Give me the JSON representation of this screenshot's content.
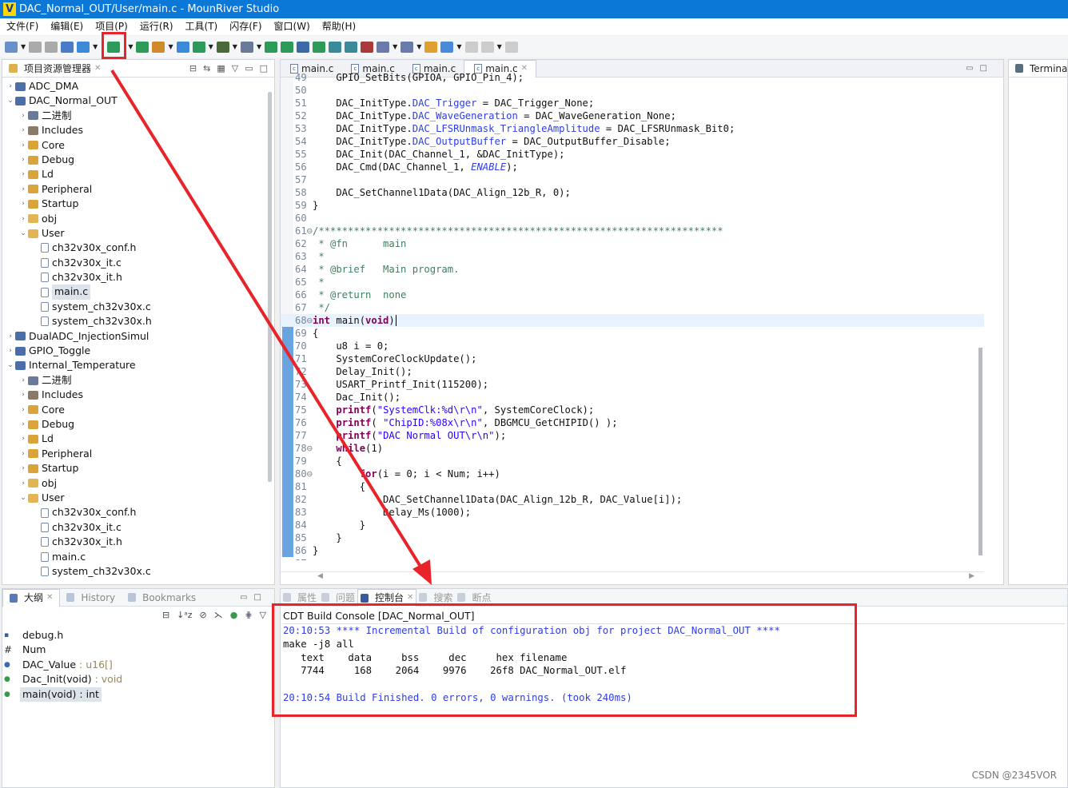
{
  "window": {
    "title": "DAC_Normal_OUT/User/main.c - MounRiver Studio"
  },
  "menu": [
    "文件(F)",
    "编辑(E)",
    "项目(P)",
    "运行(R)",
    "工具(T)",
    "闪存(F)",
    "窗口(W)",
    "帮助(H)"
  ],
  "project_explorer": {
    "title": "项目资源管理器",
    "items": [
      {
        "label": "ADC_DMA",
        "depth": 0,
        "icon": "project",
        "expanded": false
      },
      {
        "label": "DAC_Normal_OUT",
        "depth": 0,
        "icon": "project",
        "expanded": true
      },
      {
        "label": "二进制",
        "depth": 1,
        "icon": "binary",
        "expanded": false
      },
      {
        "label": "Includes",
        "depth": 1,
        "icon": "includes",
        "expanded": false
      },
      {
        "label": "Core",
        "depth": 1,
        "icon": "folder-src",
        "expanded": false
      },
      {
        "label": "Debug",
        "depth": 1,
        "icon": "folder-src",
        "expanded": false
      },
      {
        "label": "Ld",
        "depth": 1,
        "icon": "folder-src",
        "expanded": false
      },
      {
        "label": "Peripheral",
        "depth": 1,
        "icon": "folder-src",
        "expanded": false
      },
      {
        "label": "Startup",
        "depth": 1,
        "icon": "folder-src",
        "expanded": false
      },
      {
        "label": "obj",
        "depth": 1,
        "icon": "folder",
        "expanded": false
      },
      {
        "label": "User",
        "depth": 1,
        "icon": "folder",
        "expanded": true
      },
      {
        "label": "ch32v30x_conf.h",
        "depth": 2,
        "icon": "file-h"
      },
      {
        "label": "ch32v30x_it.c",
        "depth": 2,
        "icon": "file-c"
      },
      {
        "label": "ch32v30x_it.h",
        "depth": 2,
        "icon": "file-h"
      },
      {
        "label": "main.c",
        "depth": 2,
        "icon": "file-c",
        "selected": true
      },
      {
        "label": "system_ch32v30x.c",
        "depth": 2,
        "icon": "file-c"
      },
      {
        "label": "system_ch32v30x.h",
        "depth": 2,
        "icon": "file-h"
      },
      {
        "label": "DualADC_InjectionSimul",
        "depth": 0,
        "icon": "project",
        "expanded": false
      },
      {
        "label": "GPIO_Toggle",
        "depth": 0,
        "icon": "project",
        "expanded": false
      },
      {
        "label": "Internal_Temperature",
        "depth": 0,
        "icon": "project",
        "expanded": true
      },
      {
        "label": "二进制",
        "depth": 1,
        "icon": "binary",
        "expanded": false
      },
      {
        "label": "Includes",
        "depth": 1,
        "icon": "includes",
        "expanded": false
      },
      {
        "label": "Core",
        "depth": 1,
        "icon": "folder-src",
        "expanded": false
      },
      {
        "label": "Debug",
        "depth": 1,
        "icon": "folder-src",
        "expanded": false
      },
      {
        "label": "Ld",
        "depth": 1,
        "icon": "folder-src",
        "expanded": false
      },
      {
        "label": "Peripheral",
        "depth": 1,
        "icon": "folder-src",
        "expanded": false
      },
      {
        "label": "Startup",
        "depth": 1,
        "icon": "folder-src",
        "expanded": false
      },
      {
        "label": "obj",
        "depth": 1,
        "icon": "folder",
        "expanded": false
      },
      {
        "label": "User",
        "depth": 1,
        "icon": "folder",
        "expanded": true
      },
      {
        "label": "ch32v30x_conf.h",
        "depth": 2,
        "icon": "file-h"
      },
      {
        "label": "ch32v30x_it.c",
        "depth": 2,
        "icon": "file-c"
      },
      {
        "label": "ch32v30x_it.h",
        "depth": 2,
        "icon": "file-h"
      },
      {
        "label": "main.c",
        "depth": 2,
        "icon": "file-c"
      },
      {
        "label": "system_ch32v30x.c",
        "depth": 2,
        "icon": "file-c"
      }
    ]
  },
  "editor": {
    "tabs": [
      "main.c",
      "main.c",
      "main.c",
      "main.c"
    ],
    "active_tab": 3,
    "lines": [
      {
        "n": "49",
        "s": [
          [
            "    GPIO_SetBits(GPIOA, GPIO_Pin_4);",
            ""
          ]
        ]
      },
      {
        "n": "50",
        "s": []
      },
      {
        "n": "51",
        "s": [
          [
            "    DAC_InitType.",
            ""
          ],
          [
            "DAC_Trigger",
            "fld"
          ],
          [
            " = DAC_Trigger_None;",
            ""
          ]
        ]
      },
      {
        "n": "52",
        "s": [
          [
            "    DAC_InitType.",
            ""
          ],
          [
            "DAC_WaveGeneration",
            "fld"
          ],
          [
            " = DAC_WaveGeneration_None;",
            ""
          ]
        ]
      },
      {
        "n": "53",
        "s": [
          [
            "    DAC_InitType.",
            ""
          ],
          [
            "DAC_LFSRUnmask_TriangleAmplitude",
            "fld"
          ],
          [
            " = DAC_LFSRUnmask_Bit0;",
            ""
          ]
        ]
      },
      {
        "n": "54",
        "s": [
          [
            "    DAC_InitType.",
            ""
          ],
          [
            "DAC_OutputBuffer",
            "fld"
          ],
          [
            " = DAC_OutputBuffer_Disable;",
            ""
          ]
        ]
      },
      {
        "n": "55",
        "s": [
          [
            "    DAC_Init(DAC_Channel_1, &DAC_InitType);",
            ""
          ]
        ]
      },
      {
        "n": "56",
        "s": [
          [
            "    DAC_Cmd(DAC_Channel_1, ",
            ""
          ],
          [
            "ENABLE",
            "en"
          ],
          [
            ");",
            ""
          ]
        ]
      },
      {
        "n": "57",
        "s": []
      },
      {
        "n": "58",
        "s": [
          [
            "    DAC_SetChannel1Data(DAC_Align_12b_R, 0);",
            ""
          ]
        ]
      },
      {
        "n": "59",
        "s": [
          [
            "}",
            ""
          ]
        ]
      },
      {
        "n": "60",
        "s": []
      },
      {
        "n": "61⊖",
        "s": [
          [
            "/*********************************************************************",
            "cm"
          ]
        ]
      },
      {
        "n": "62",
        "s": [
          [
            " * @fn      main",
            "cm"
          ]
        ]
      },
      {
        "n": "63",
        "s": [
          [
            " *",
            "cm"
          ]
        ]
      },
      {
        "n": "64",
        "s": [
          [
            " * @brief   Main program.",
            "cm"
          ]
        ]
      },
      {
        "n": "65",
        "s": [
          [
            " *",
            "cm"
          ]
        ]
      },
      {
        "n": "66",
        "s": [
          [
            " * @return  none",
            "cm"
          ]
        ]
      },
      {
        "n": "67",
        "s": [
          [
            " */",
            "cm"
          ]
        ]
      },
      {
        "n": "68⊖",
        "s": [
          [
            "int",
            "kw"
          ],
          [
            " main(",
            ""
          ],
          [
            "void",
            "kw"
          ],
          [
            ")",
            ""
          ]
        ],
        "current": true
      },
      {
        "n": "69",
        "s": [
          [
            "{",
            ""
          ]
        ]
      },
      {
        "n": "70",
        "s": [
          [
            "    u8 i = 0;",
            ""
          ]
        ]
      },
      {
        "n": "71",
        "s": [
          [
            "    SystemCoreClockUpdate();",
            ""
          ]
        ]
      },
      {
        "n": "72",
        "s": [
          [
            "    Delay_Init();",
            ""
          ]
        ]
      },
      {
        "n": "73",
        "s": [
          [
            "    USART_Printf_Init(115200);",
            ""
          ]
        ]
      },
      {
        "n": "74",
        "s": [
          [
            "    Dac_Init();",
            ""
          ]
        ]
      },
      {
        "n": "75",
        "s": [
          [
            "    ",
            ""
          ],
          [
            "printf",
            "kw"
          ],
          [
            "(",
            ""
          ],
          [
            "\"SystemClk:%d\\r\\n\"",
            "str"
          ],
          [
            ", SystemCoreClock);",
            ""
          ]
        ]
      },
      {
        "n": "76",
        "s": [
          [
            "    ",
            ""
          ],
          [
            "printf",
            "kw"
          ],
          [
            "( ",
            ""
          ],
          [
            "\"ChipID:%08x\\r\\n\"",
            "str"
          ],
          [
            ", DBGMCU_GetCHIPID() );",
            ""
          ]
        ]
      },
      {
        "n": "77",
        "s": [
          [
            "    ",
            ""
          ],
          [
            "printf",
            "kw"
          ],
          [
            "(",
            ""
          ],
          [
            "\"DAC Normal OUT\\r\\n\"",
            "str"
          ],
          [
            ");",
            ""
          ]
        ]
      },
      {
        "n": "78⊖",
        "s": [
          [
            "    ",
            ""
          ],
          [
            "while",
            "kw"
          ],
          [
            "(1)",
            ""
          ]
        ]
      },
      {
        "n": "79",
        "s": [
          [
            "    {",
            ""
          ]
        ]
      },
      {
        "n": "80⊖",
        "s": [
          [
            "        ",
            ""
          ],
          [
            "for",
            "kw"
          ],
          [
            "(i = 0; i < Num; i++)",
            ""
          ]
        ]
      },
      {
        "n": "81",
        "s": [
          [
            "        {",
            ""
          ]
        ]
      },
      {
        "n": "82",
        "s": [
          [
            "            DAC_SetChannel1Data(DAC_Align_12b_R, DAC_Value[i]);",
            ""
          ]
        ]
      },
      {
        "n": "83",
        "s": [
          [
            "            Delay_Ms(1000);",
            ""
          ]
        ]
      },
      {
        "n": "84",
        "s": [
          [
            "        }",
            ""
          ]
        ]
      },
      {
        "n": "85",
        "s": [
          [
            "    }",
            ""
          ]
        ]
      },
      {
        "n": "86",
        "s": [
          [
            "}",
            ""
          ]
        ]
      },
      {
        "n": "87",
        "s": []
      }
    ]
  },
  "terminal": {
    "title": "Terminal"
  },
  "outline": {
    "tabs": [
      "大纲",
      "History",
      "Bookmarks"
    ],
    "items": [
      {
        "name": "debug.h",
        "type": "",
        "icon": "include"
      },
      {
        "name": "Num",
        "type": "",
        "icon": "macro"
      },
      {
        "name": "DAC_Value",
        "type": " : u16[]",
        "icon": "variable"
      },
      {
        "name": "Dac_Init(void)",
        "type": " : void",
        "icon": "function"
      },
      {
        "name": "main(void)",
        "type": " : int",
        "icon": "function",
        "selected": true
      }
    ]
  },
  "console": {
    "tabs": [
      "属性",
      "问题",
      "控制台",
      "搜索",
      "断点"
    ],
    "active_tab": 2,
    "title": "CDT Build Console [DAC_Normal_OUT]",
    "lines": [
      {
        "text": "20:10:53 **** Incremental Build of configuration obj for project DAC_Normal_OUT ****",
        "blue": true
      },
      {
        "text": "make -j8 all",
        "blue": false
      },
      {
        "text": "   text    data     bss     dec     hex filename",
        "blue": false
      },
      {
        "text": "   7744     168    2064    9976    26f8 DAC_Normal_OUT.elf",
        "blue": false
      },
      {
        "text": "",
        "blue": false
      },
      {
        "text": "20:10:54 Build Finished. 0 errors, 0 warnings. (took 240ms)",
        "blue": true
      }
    ]
  },
  "watermark": "CSDN @2345VOR",
  "colors": {
    "accent": "#0b78d7",
    "annotation": "#e8242a"
  }
}
